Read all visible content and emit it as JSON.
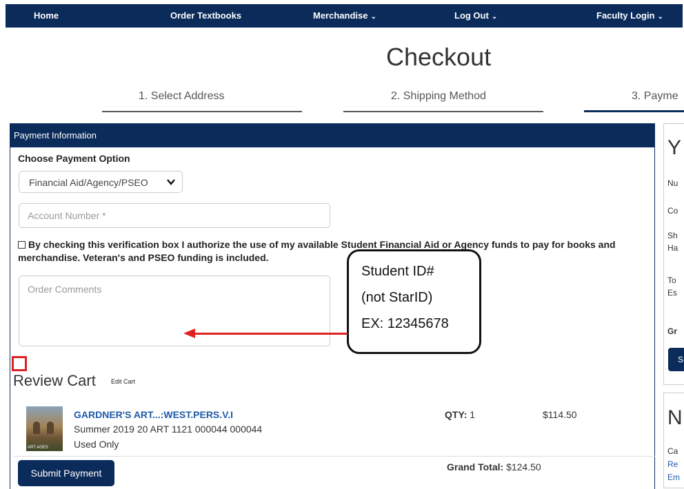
{
  "nav": {
    "home": "Home",
    "order_textbooks": "Order Textbooks",
    "merchandise": "Merchandise",
    "logout": "Log Out",
    "faculty_login": "Faculty Login",
    "caret": "⌄"
  },
  "page_title": "Checkout",
  "steps": [
    "1. Select Address",
    "2. Shipping Method",
    "3. Payme"
  ],
  "payment": {
    "header": "Payment Information",
    "choose_label": "Choose Payment Option",
    "payment_option": "Financial Aid/Agency/PSEO",
    "account_placeholder": "Account Number *",
    "verification_text": "By checking this verification box I authorize the use of my available Student Financial Aid or Agency funds to pay for books and merchandise. Veteran's and PSEO funding is included.",
    "comments_placeholder": "Order Comments"
  },
  "callout": {
    "line1": "Student ID#",
    "line2": "(not StarID)",
    "line3": "EX: 12345678"
  },
  "cart": {
    "heading": "Review Cart",
    "edit_link": "Edit Cart",
    "items": [
      {
        "title": "GARDNER'S ART...:WEST.PERS.V.I",
        "term": "Summer 2019 20 ART 1121 000044 000044",
        "condition": "Used Only",
        "qty_label": "QTY:",
        "qty": "1",
        "price": "$114.50",
        "thumb_text": "ART AGES"
      }
    ],
    "grand_total_label": "Grand Total:",
    "grand_total": "$124.50",
    "submit_label": "Submit Payment"
  },
  "sidebar_right": {
    "summary_heading": "Y",
    "lines": [
      "Nu",
      "Co",
      "Sh",
      "Ha",
      "To",
      "Es"
    ],
    "grand": "Gr",
    "button": "S",
    "notes_heading": "N",
    "notes_line1": "Ca",
    "notes_link1": "Re",
    "notes_link2": "Em"
  },
  "colors": {
    "navy": "#0b2b5b",
    "link_blue": "#1f5aa8",
    "annotation_red": "#e02020"
  }
}
